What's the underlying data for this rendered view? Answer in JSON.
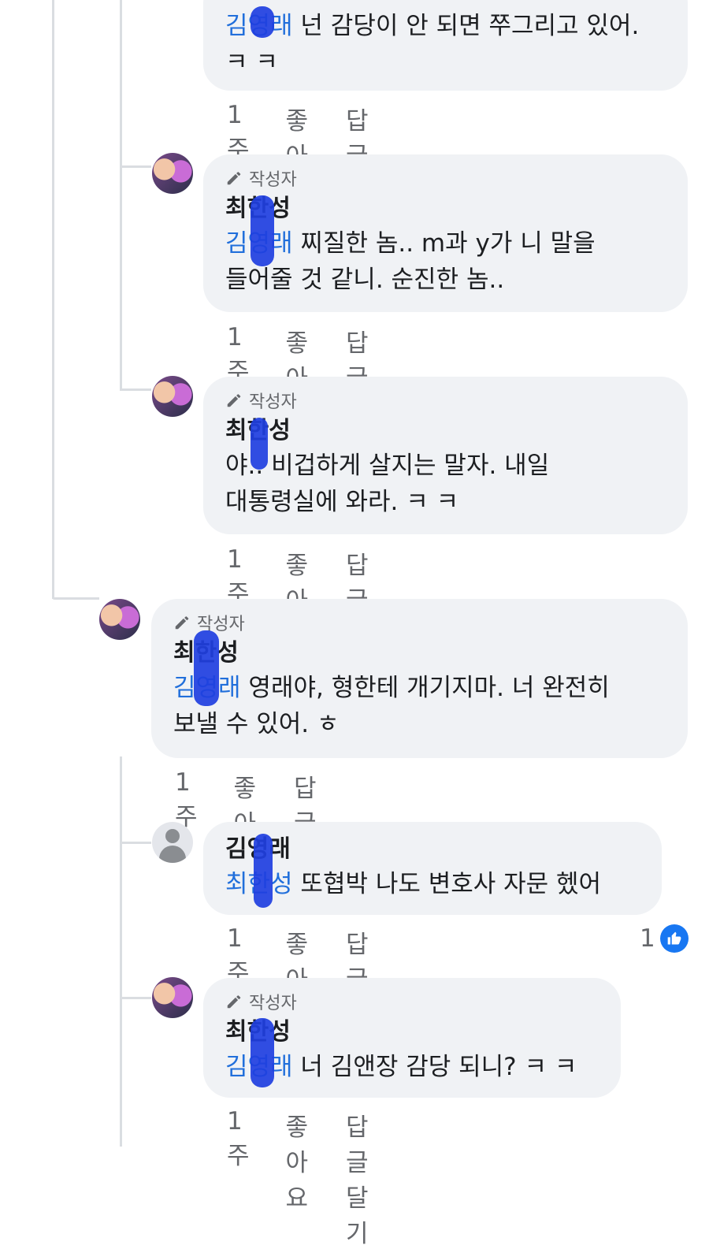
{
  "author_badge": "작성자",
  "actions": {
    "time": "1주",
    "like": "좋아요",
    "reply": "답글 달기"
  },
  "comments": [
    {
      "mention": "김영래",
      "text": "넌 감당이 안 되면 쭈그리고 있어. ㅋ ㅋ"
    },
    {
      "author": "최한성",
      "mention": "김영래",
      "text_line1": "찌질한 놈.. m과 y가 니 말을",
      "text_line2": "들어줄 것 같니. 순진한 놈.."
    },
    {
      "author": "최한성",
      "text_line1": "야.. 비겁하게 살지는 말자. 내일",
      "text_line2": "대통령실에 와라. ㅋ ㅋ"
    },
    {
      "author": "최한성",
      "mention": "김영래",
      "text_line1": "영래야, 형한테 개기지마. 너 완전히",
      "text_line2": "보낼 수 있어. ㅎ"
    },
    {
      "author": "김영래",
      "mention": "최한성",
      "text": "또협박  나도 변호사 자문 헸어",
      "like_count": "1"
    },
    {
      "author": "최한성",
      "mention": "김영래",
      "text": "너 김앤장 감당 되니? ㅋ ㅋ"
    }
  ],
  "icons": {
    "badge": "pencil-icon",
    "like": "thumbs-up-icon"
  },
  "colors": {
    "mention": "#216fdb",
    "bubble": "#f0f2f5",
    "like": "#1877f2"
  }
}
